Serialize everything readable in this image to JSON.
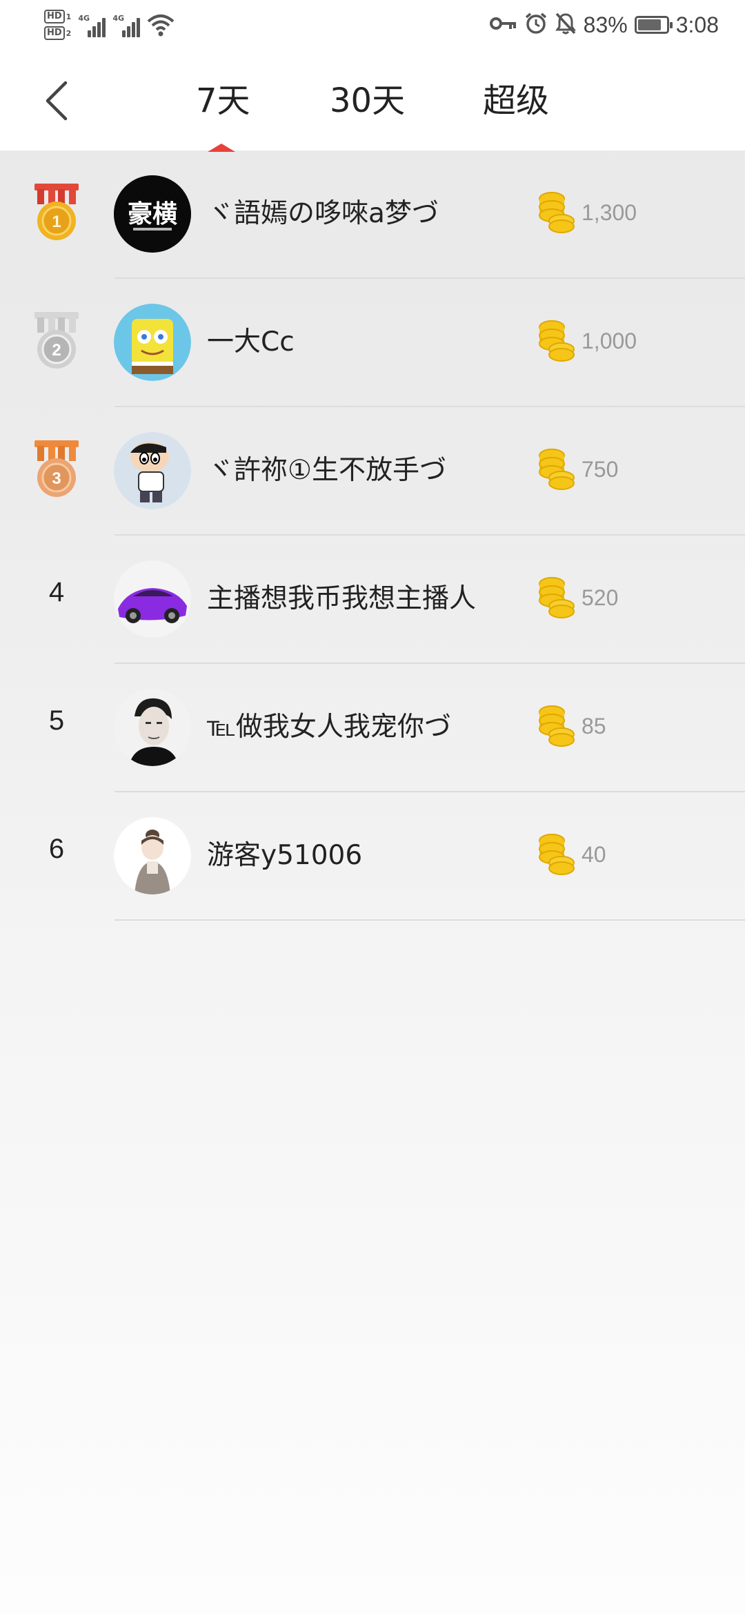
{
  "status_bar": {
    "left_icons": [
      "hd-1-badge",
      "hd-2-badge",
      "signal-4g-icon",
      "signal-4g-icon",
      "wifi-icon"
    ],
    "network_label": "4G",
    "hd1": "HD",
    "hd1_num": "1",
    "hd2": "HD",
    "hd2_num": "2",
    "right_icons": [
      "key-icon",
      "alarm-icon",
      "mute-icon"
    ],
    "battery_percent": "83%",
    "battery_level": 0.83,
    "time": "3:08"
  },
  "header": {
    "back_icon": "chevron-left-icon",
    "tabs": [
      {
        "label": "7天",
        "active": true
      },
      {
        "label": "30天",
        "active": false
      },
      {
        "label": "超级",
        "active": false
      }
    ],
    "indicator_color": "#e8403a"
  },
  "leaderboard": [
    {
      "rank": "1",
      "medal": "gold",
      "name": "ヾ語嫣の哆唻a梦づ",
      "coins": "1,300"
    },
    {
      "rank": "2",
      "medal": "silver",
      "name": "一大Cc",
      "coins": "1,000"
    },
    {
      "rank": "3",
      "medal": "bronze",
      "name": "ヾ許祢①生不放手づ",
      "coins": "750"
    },
    {
      "rank": "4",
      "medal": null,
      "name": "主播想我币我想主播人",
      "coins": "520"
    },
    {
      "rank": "5",
      "medal": null,
      "name": "℡做我女人我宠你づ",
      "coins": "85"
    },
    {
      "rank": "6",
      "medal": null,
      "name": "游客y51006",
      "coins": "40"
    }
  ],
  "avatar_1_text": "豪横",
  "coin_icon": "gold-coins-icon",
  "colors": {
    "gold": "#e8a21a",
    "silver": "#b5b5b5",
    "bronze": "#e0965c",
    "ribbon_red": "#e2483a",
    "coin": "#f5c518"
  }
}
